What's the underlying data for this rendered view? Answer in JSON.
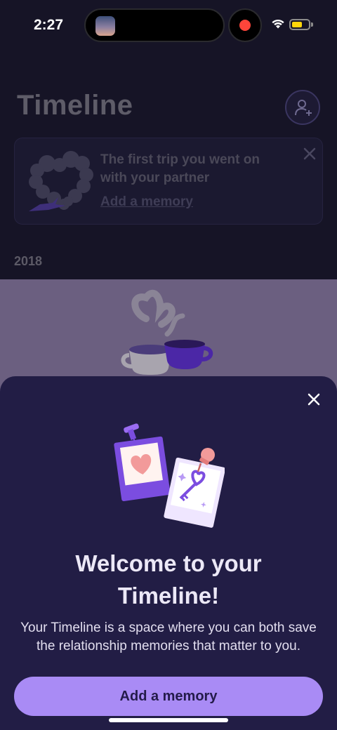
{
  "status_bar": {
    "time": "2:27",
    "record_color": "#ff453a",
    "battery_color": "#ffd60a",
    "icons": [
      "wifi-icon",
      "battery-icon"
    ]
  },
  "header": {
    "title": "Timeline",
    "add_partner_icon": "person-plus-icon"
  },
  "prompt_card": {
    "text": "The first trip you went on with your partner",
    "link": "Add a memory",
    "icons": [
      "heart-smoke-icon",
      "plane-icon",
      "close-icon"
    ]
  },
  "timeline": {
    "year": "2018"
  },
  "sheet": {
    "title": "Welcome to your Timeline!",
    "body": "Your Timeline is a space where you can both save the relationship memories that matter to you.",
    "button_label": "Add a memory",
    "accent": "#a98bf5",
    "background": "#221d45",
    "icons": [
      "close-icon",
      "polaroid-heart-icon",
      "polaroid-key-icon"
    ]
  }
}
